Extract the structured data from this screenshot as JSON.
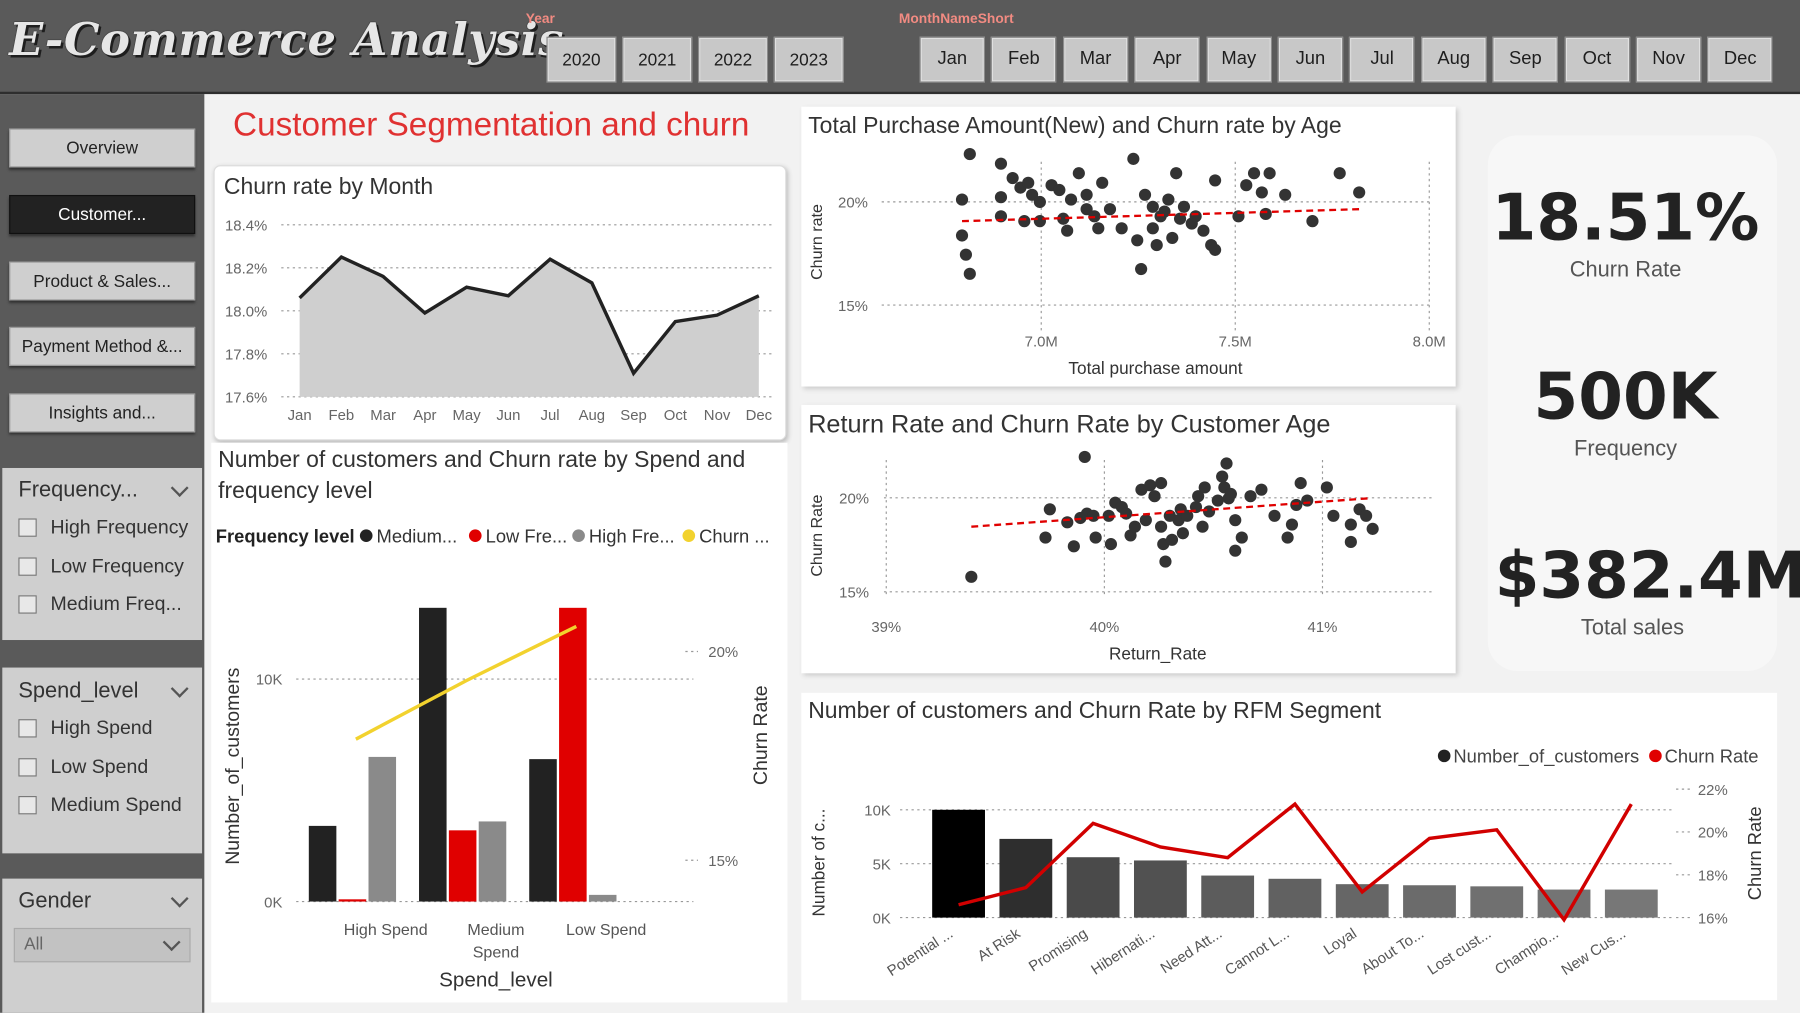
{
  "header": {
    "title": "E-Commerce Analysis",
    "year_label": "Year",
    "years": [
      "2020",
      "2021",
      "2022",
      "2023"
    ],
    "month_label": "MonthNameShort",
    "months": [
      "Jan",
      "Feb",
      "Mar",
      "Apr",
      "May",
      "Jun",
      "Jul",
      "Aug",
      "Sep",
      "Oct",
      "Nov",
      "Dec"
    ]
  },
  "sidebar": {
    "nav": [
      {
        "label": "Overview",
        "active": false
      },
      {
        "label": "Customer...",
        "active": true
      },
      {
        "label": "Product & Sales...",
        "active": false
      },
      {
        "label": "Payment Method &...",
        "active": false
      },
      {
        "label": "Insights and...",
        "active": false
      }
    ],
    "filters": {
      "frequency": {
        "title": "Frequency...",
        "options": [
          "High Frequency",
          "Low Frequency",
          "Medium Freq..."
        ]
      },
      "spend": {
        "title": "Spend_level",
        "options": [
          "High Spend",
          "Low Spend",
          "Medium Spend"
        ]
      },
      "gender": {
        "title": "Gender",
        "selected": "All"
      }
    }
  },
  "page_title": "Customer Segmentation and churn",
  "kpis": [
    {
      "value": "18.51%",
      "label": "Churn  Rate"
    },
    {
      "value": "500K",
      "label": "Frequency"
    },
    {
      "value": "$382.4M",
      "label": "Total sales"
    }
  ],
  "colors": {
    "accent": "#e03131",
    "churn_line": "#222222",
    "yellow": "#f2d22e",
    "red": "#e00000",
    "dark": "#222222",
    "grey": "#8a8a8a"
  },
  "chart_data": [
    {
      "id": "churn_month",
      "type": "area",
      "title": "Churn rate by Month",
      "categories": [
        "Jan",
        "Feb",
        "Mar",
        "Apr",
        "May",
        "Jun",
        "Jul",
        "Aug",
        "Sep",
        "Oct",
        "Nov",
        "Dec"
      ],
      "values": [
        18.06,
        18.25,
        18.16,
        17.99,
        18.11,
        18.07,
        18.24,
        18.13,
        17.71,
        17.95,
        17.98,
        18.07
      ],
      "ylim": [
        17.6,
        18.4
      ],
      "yticks": [
        "18.4%",
        "18.2%",
        "18.0%",
        "17.8%",
        "17.6%"
      ],
      "grid": true
    },
    {
      "id": "spend_freq",
      "type": "bar",
      "title": "Number of customers and Churn rate by Spend and frequency level",
      "legend_title": "Frequency level",
      "legend": [
        "Medium...",
        "Low Fre...",
        "High Fre...",
        "Churn ..."
      ],
      "categories": [
        "High Spend",
        "Medium Spend",
        "Low Spend"
      ],
      "series": [
        {
          "name": "Medium...",
          "values": [
            3400,
            13200,
            6400
          ]
        },
        {
          "name": "Low Fre...",
          "values": [
            100,
            3200,
            13200
          ]
        },
        {
          "name": "High Fre...",
          "values": [
            6500,
            3600,
            300
          ]
        },
        {
          "name": "Churn ...",
          "values": [
            17.9,
            19.3,
            20.6
          ]
        }
      ],
      "xlabel": "Spend_level",
      "ylabel": "Number_of_customers",
      "y2label": "Churn Rate",
      "yticks": [
        "10K",
        "0K"
      ],
      "y2ticks": [
        "20%",
        "15%"
      ]
    },
    {
      "id": "purchase_age",
      "type": "scatter",
      "title": "Total Purchase Amount(New) and Churn rate by Age",
      "xlabel": "Total purchase amount",
      "ylabel": "Churn rate",
      "xticks": [
        "7.0M",
        "7.5M",
        "8.0M"
      ],
      "yticks": [
        "20%",
        "15%"
      ],
      "xlim": [
        6.8,
        8.0
      ],
      "ylim": [
        13.5,
        21.5
      ],
      "points": [
        [
          6.82,
          21.1
        ],
        [
          6.8,
          19.2
        ],
        [
          6.8,
          17.7
        ],
        [
          6.81,
          16.9
        ],
        [
          6.82,
          16.1
        ],
        [
          6.9,
          20.7
        ],
        [
          6.9,
          19.3
        ],
        [
          6.9,
          18.5
        ],
        [
          6.93,
          20.1
        ],
        [
          6.95,
          19.7
        ],
        [
          6.97,
          19.9
        ],
        [
          6.98,
          19.4
        ],
        [
          7.0,
          18.3
        ],
        [
          6.96,
          18.3
        ],
        [
          7.03,
          19.8
        ],
        [
          7.05,
          19.6
        ],
        [
          7.06,
          18.4
        ],
        [
          7.07,
          17.9
        ],
        [
          7.1,
          20.3
        ],
        [
          7.12,
          19.4
        ],
        [
          7.12,
          18.8
        ],
        [
          7.14,
          18.5
        ],
        [
          7.15,
          18.0
        ],
        [
          7.16,
          19.9
        ],
        [
          7.18,
          18.8
        ],
        [
          7.21,
          18.0
        ],
        [
          7.24,
          20.9
        ],
        [
          7.25,
          17.5
        ],
        [
          7.26,
          16.3
        ],
        [
          7.27,
          19.4
        ],
        [
          7.29,
          18.9
        ],
        [
          7.29,
          18.0
        ],
        [
          7.3,
          17.3
        ],
        [
          7.31,
          18.5
        ],
        [
          7.33,
          19.2
        ],
        [
          7.32,
          18.7
        ],
        [
          7.34,
          17.6
        ],
        [
          7.35,
          20.3
        ],
        [
          7.36,
          18.4
        ],
        [
          7.37,
          18.9
        ],
        [
          7.39,
          18.2
        ],
        [
          7.4,
          18.5
        ],
        [
          7.42,
          17.9
        ],
        [
          7.44,
          17.3
        ],
        [
          7.45,
          20.0
        ],
        [
          7.45,
          17.1
        ],
        [
          7.51,
          18.5
        ],
        [
          7.53,
          19.8
        ],
        [
          7.55,
          20.3
        ],
        [
          7.57,
          19.5
        ],
        [
          7.58,
          18.6
        ],
        [
          7.59,
          20.3
        ],
        [
          7.63,
          19.4
        ],
        [
          7.7,
          18.3
        ],
        [
          7.77,
          20.3
        ],
        [
          7.82,
          19.5
        ],
        [
          7.0,
          19.1
        ],
        [
          7.08,
          19.2
        ]
      ],
      "trend": [
        [
          6.8,
          18.3
        ],
        [
          7.82,
          18.8
        ]
      ],
      "grid": true
    },
    {
      "id": "return_age",
      "type": "scatter",
      "title": "Return Rate and Churn Rate by Customer Age",
      "xlabel": "Return_Rate",
      "ylabel": "Churn Rate",
      "xticks": [
        "39%",
        "40%",
        "41%"
      ],
      "yticks": [
        "20%",
        "15%"
      ],
      "xlim": [
        39.0,
        41.5
      ],
      "ylim": [
        14.0,
        22.0
      ],
      "points": [
        [
          39.39,
          15.9
        ],
        [
          39.73,
          17.7
        ],
        [
          39.75,
          19.0
        ],
        [
          39.83,
          18.4
        ],
        [
          39.86,
          17.3
        ],
        [
          39.89,
          18.6
        ],
        [
          39.92,
          18.8
        ],
        [
          39.95,
          18.7
        ],
        [
          39.96,
          17.7
        ],
        [
          39.91,
          21.4
        ],
        [
          40.02,
          18.7
        ],
        [
          40.05,
          19.3
        ],
        [
          40.03,
          17.4
        ],
        [
          40.08,
          19.1
        ],
        [
          40.1,
          18.8
        ],
        [
          40.12,
          17.8
        ],
        [
          40.14,
          18.2
        ],
        [
          40.17,
          19.9
        ],
        [
          40.19,
          18.5
        ],
        [
          40.21,
          20.1
        ],
        [
          40.23,
          19.6
        ],
        [
          40.26,
          18.2
        ],
        [
          40.26,
          20.2
        ],
        [
          40.27,
          17.4
        ],
        [
          40.28,
          16.6
        ],
        [
          40.3,
          18.7
        ],
        [
          40.31,
          17.6
        ],
        [
          40.34,
          18.5
        ],
        [
          40.35,
          19.0
        ],
        [
          40.36,
          17.9
        ],
        [
          40.38,
          18.7
        ],
        [
          40.42,
          19.1
        ],
        [
          40.43,
          19.6
        ],
        [
          40.45,
          18.2
        ],
        [
          40.46,
          20.0
        ],
        [
          40.48,
          18.9
        ],
        [
          40.52,
          19.4
        ],
        [
          40.54,
          20.5
        ],
        [
          40.55,
          20.0
        ],
        [
          40.56,
          21.1
        ],
        [
          40.57,
          19.5
        ],
        [
          40.58,
          19.7
        ],
        [
          40.6,
          18.5
        ],
        [
          40.63,
          17.7
        ],
        [
          40.6,
          17.1
        ],
        [
          40.67,
          19.6
        ],
        [
          40.72,
          19.9
        ],
        [
          40.78,
          18.7
        ],
        [
          40.84,
          17.7
        ],
        [
          40.86,
          18.3
        ],
        [
          40.88,
          19.2
        ],
        [
          40.9,
          20.2
        ],
        [
          40.93,
          19.4
        ],
        [
          41.05,
          18.7
        ],
        [
          41.02,
          20.0
        ],
        [
          41.13,
          18.3
        ],
        [
          41.17,
          19.0
        ],
        [
          41.13,
          17.5
        ],
        [
          41.23,
          18.1
        ],
        [
          41.2,
          18.7
        ]
      ],
      "trend": [
        [
          39.39,
          18.2
        ],
        [
          41.21,
          19.5
        ]
      ],
      "grid": true
    },
    {
      "id": "rfm",
      "type": "bar",
      "title": "Number of customers and Churn Rate by RFM Segment",
      "legend": [
        "Number_of_customers",
        "Churn  Rate"
      ],
      "categories": [
        "Potential ...",
        "At Risk",
        "Promising",
        "Hibernati...",
        "Need Att...",
        "Cannot L...",
        "Loyal",
        "About To...",
        "Lost cust...",
        "Champio...",
        "New Cus..."
      ],
      "series": [
        {
          "name": "Number_of_customers",
          "values": [
            10000,
            7300,
            5600,
            5300,
            3900,
            3600,
            3100,
            3000,
            2900,
            2600,
            2600
          ]
        },
        {
          "name": "Churn  Rate",
          "values": [
            16.6,
            17.4,
            20.4,
            19.3,
            18.8,
            21.3,
            17.2,
            19.7,
            20.1,
            15.9,
            21.3
          ]
        }
      ],
      "ylabel": "Number of c...",
      "y2label": "Churn Rate",
      "yticks": [
        "10K",
        "5K",
        "0K"
      ],
      "y2ticks": [
        "22%",
        "20%",
        "18%",
        "16%"
      ]
    }
  ]
}
